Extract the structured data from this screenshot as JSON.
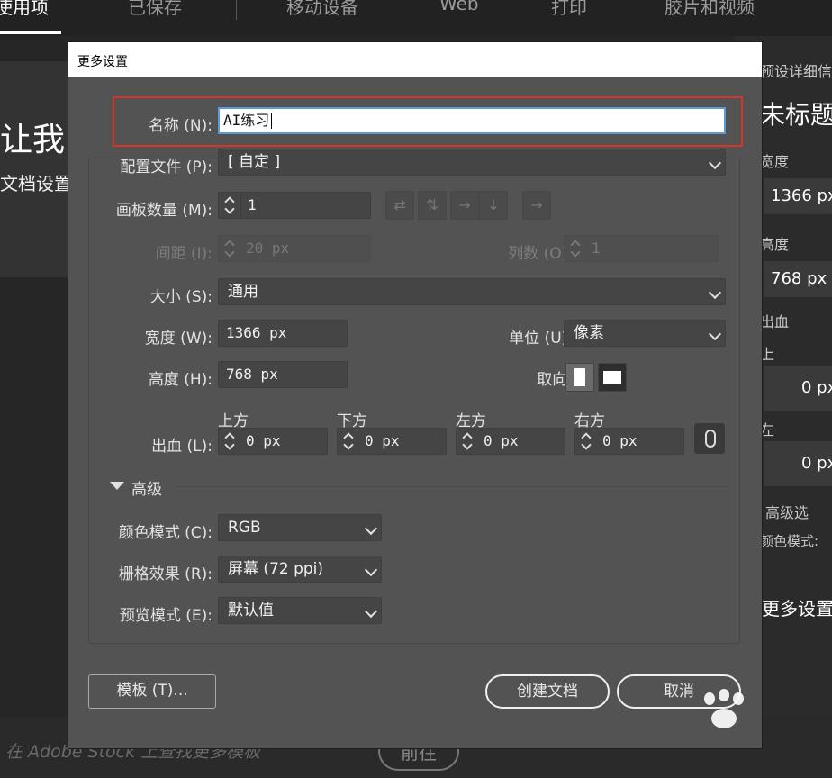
{
  "top_tabs": [
    {
      "label": "使用项",
      "active": true
    },
    {
      "label": "已保存",
      "active": false
    },
    {
      "label": "移动设备",
      "active": false
    },
    {
      "label": "Web",
      "active": false
    },
    {
      "label": "打印",
      "active": false
    },
    {
      "label": "胶片和视频",
      "active": false
    }
  ],
  "hero": {
    "title": "让我",
    "subtitle": "文档设置"
  },
  "right_panel": {
    "header": "预设详细信",
    "doc_title": "未标题",
    "width_label": "宽度",
    "width_value": "1366 px",
    "height_label": "高度",
    "height_value": "768 px",
    "bleed_label": "出血",
    "top_label": "上",
    "top_value": "0 px",
    "left_label": "左",
    "left_value": "0 px",
    "advanced": "高级选",
    "color_mode": "颜色模式:",
    "more_settings": "更多设置"
  },
  "bottom": {
    "stock_text": "在 Adobe Stock 上查找更多模板",
    "goto_label": "前往"
  },
  "dialog": {
    "title": "更多设置",
    "name_label": "名称 (N):",
    "name_value": "AI练习",
    "profile_label": "配置文件 (P):",
    "profile_value": "[ 自定 ]",
    "artboards_label": "画板数量 (M):",
    "artboards_value": "1",
    "spacing_label": "间距 (I):",
    "spacing_value": "20 px",
    "columns_label": "列数 (O):",
    "columns_value": "1",
    "size_label": "大小 (S):",
    "size_value": "通用",
    "width_label": "宽度 (W):",
    "width_value": "1366 px",
    "units_label": "单位 (U):",
    "units_value": "像素",
    "height_label": "高度 (H):",
    "height_value": "768 px",
    "orientation_label": "取向:",
    "bleed_label": "出血 (L):",
    "bleed_top_label": "上方",
    "bleed_top_value": "0 px",
    "bleed_bottom_label": "下方",
    "bleed_bottom_value": "0 px",
    "bleed_left_label": "左方",
    "bleed_left_value": "0 px",
    "bleed_right_label": "右方",
    "bleed_right_value": "0 px",
    "advanced_label": "高级",
    "color_mode_label": "颜色模式 (C):",
    "color_mode_value": "RGB",
    "raster_label": "栅格效果 (R):",
    "raster_value": "屏幕 (72 ppi)",
    "preview_label": "预览模式 (E):",
    "preview_value": "默认值",
    "template_button": "模板 (T)...",
    "create_button": "创建文档",
    "cancel_button": "取消"
  },
  "colors": {
    "highlight": "#d9342c",
    "dialog_bg": "#535353",
    "focus": "#5b9bd5"
  }
}
